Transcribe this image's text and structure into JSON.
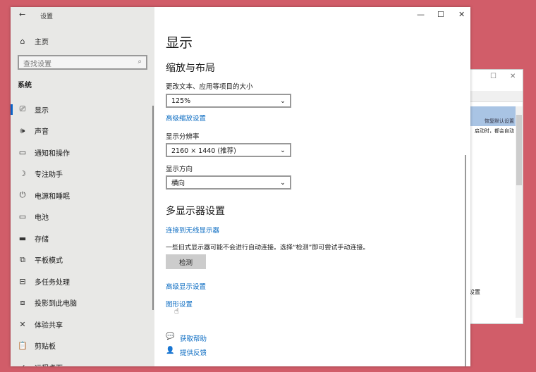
{
  "back_window": {
    "banner": "恢复默认设置",
    "text": "启动时，都会自动",
    "bottom_text": "设置"
  },
  "window": {
    "title": "设置",
    "back": "←",
    "min": "—",
    "max": "☐",
    "close": "✕"
  },
  "sidebar": {
    "home": "主页",
    "search_placeholder": "查找设置",
    "section": "系统",
    "items": [
      {
        "icon": "⎚",
        "label": "显示",
        "name": "display"
      },
      {
        "icon": "🕪",
        "label": "声音",
        "name": "sound"
      },
      {
        "icon": "▭",
        "label": "通知和操作",
        "name": "notifications"
      },
      {
        "icon": "☽",
        "label": "专注助手",
        "name": "focus-assist"
      },
      {
        "icon": "⏻",
        "label": "电源和睡眠",
        "name": "power-sleep"
      },
      {
        "icon": "▭",
        "label": "电池",
        "name": "battery"
      },
      {
        "icon": "▬",
        "label": "存储",
        "name": "storage"
      },
      {
        "icon": "⧉",
        "label": "平板模式",
        "name": "tablet-mode"
      },
      {
        "icon": "⊟",
        "label": "多任务处理",
        "name": "multitasking"
      },
      {
        "icon": "⧈",
        "label": "投影到此电脑",
        "name": "projecting"
      },
      {
        "icon": "✕",
        "label": "体验共享",
        "name": "shared-experiences"
      },
      {
        "icon": "📋",
        "label": "剪贴板",
        "name": "clipboard"
      },
      {
        "icon": "✓",
        "label": "远程桌面",
        "name": "remote-desktop"
      }
    ]
  },
  "main": {
    "title": "显示",
    "scale_heading": "缩放与布局",
    "scale_label": "更改文本、应用等项目的大小",
    "scale_value": "125%",
    "advanced_scaling": "高级缩放设置",
    "resolution_label": "显示分辨率",
    "resolution_value": "2160 × 1440 (推荐)",
    "orientation_label": "显示方向",
    "orientation_value": "横向",
    "multi_heading": "多显示器设置",
    "wireless_link": "连接到无线显示器",
    "detect_text": "一些旧式显示器可能不会进行自动连接。选择“检测”即可尝试手动连接。",
    "detect_button": "检测",
    "advanced_display": "高级显示设置",
    "graphics_settings": "图形设置",
    "get_help": "获取帮助",
    "feedback": "提供反馈"
  }
}
